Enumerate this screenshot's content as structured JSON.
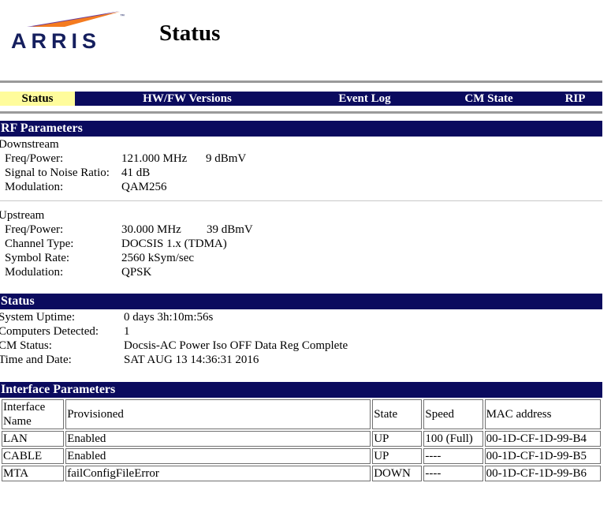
{
  "brand": {
    "name": "ARRIS",
    "tm": "™"
  },
  "page_title": "Status",
  "nav": [
    {
      "label": "Status",
      "active": true
    },
    {
      "label": "HW/FW Versions",
      "active": false
    },
    {
      "label": "Event Log",
      "active": false
    },
    {
      "label": "CM State",
      "active": false
    },
    {
      "label": "RIP",
      "active": false
    }
  ],
  "rf": {
    "header": "RF Parameters",
    "downstream": {
      "title": "Downstream",
      "freq_label": "Freq/Power:",
      "freq_value": "121.000 MHz",
      "power_value": "9 dBmV",
      "snr_label": "Signal to Noise Ratio:",
      "snr_value": "41 dB",
      "mod_label": "Modulation:",
      "mod_value": "QAM256"
    },
    "upstream": {
      "title": "Upstream",
      "freq_label": "Freq/Power:",
      "freq_value": "30.000 MHz",
      "power_value": "39 dBmV",
      "channel_label": "Channel Type:",
      "channel_value": "DOCSIS 1.x (TDMA)",
      "symbol_label": "Symbol Rate:",
      "symbol_value": "2560 kSym/sec",
      "mod_label": "Modulation:",
      "mod_value": "QPSK"
    }
  },
  "status": {
    "header": "Status",
    "uptime_label": "System Uptime:",
    "uptime_value": "0 days 3h:10m:56s",
    "computers_label": "Computers Detected:",
    "computers_value": "1",
    "cm_label": "CM Status:",
    "cm_value": "Docsis-AC Power Iso OFF Data Reg Complete",
    "time_label": "Time and Date:",
    "time_value": "SAT AUG 13 14:36:31 2016"
  },
  "interface": {
    "header": "Interface Parameters",
    "columns": [
      "Interface Name",
      "Provisioned",
      "State",
      "Speed",
      "MAC address"
    ],
    "rows": [
      [
        "LAN",
        "Enabled",
        "UP",
        "100 (Full)",
        "00-1D-CF-1D-99-B4"
      ],
      [
        "CABLE",
        "Enabled",
        "UP",
        "----",
        "00-1D-CF-1D-99-B5"
      ],
      [
        "MTA",
        "failConfigFileError",
        "DOWN",
        "----",
        "00-1D-CF-1D-99-B6"
      ]
    ]
  },
  "colors": {
    "nav_bg": "#0b0b5e",
    "nav_active": "#fffc9c",
    "logo": "#151f5e",
    "logo_swoosh_purple": "#6a3d9a",
    "logo_swoosh_orange": "#f47b20"
  }
}
